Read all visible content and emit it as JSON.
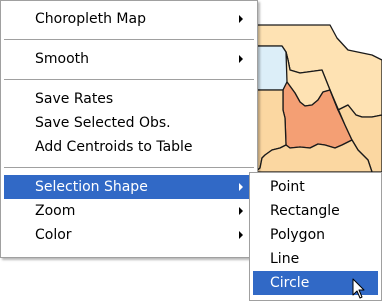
{
  "colors": {
    "accent": "#3169c6",
    "county_light": "#fbd7a1",
    "county_mid": "#fee2b3",
    "county_pale_blue": "#dceef8",
    "county_highlight": "#f49f74",
    "county_border": "#1a1a1a"
  },
  "context_menu": {
    "items": [
      {
        "label": "Choropleth Map",
        "has_submenu": true
      },
      {
        "label": "Smooth",
        "has_submenu": true
      },
      {
        "label": "Save Rates",
        "has_submenu": false
      },
      {
        "label": "Save Selected Obs.",
        "has_submenu": false
      },
      {
        "label": "Add Centroids to Table",
        "has_submenu": false
      },
      {
        "label": "Selection Shape",
        "has_submenu": true,
        "selected": true
      },
      {
        "label": "Zoom",
        "has_submenu": true
      },
      {
        "label": "Color",
        "has_submenu": true
      }
    ]
  },
  "selection_shape_submenu": {
    "items": [
      {
        "label": "Point"
      },
      {
        "label": "Rectangle"
      },
      {
        "label": "Polygon"
      },
      {
        "label": "Line"
      },
      {
        "label": "Circle",
        "selected": true
      }
    ]
  },
  "cursor_icon": "arrow-pointer-icon"
}
